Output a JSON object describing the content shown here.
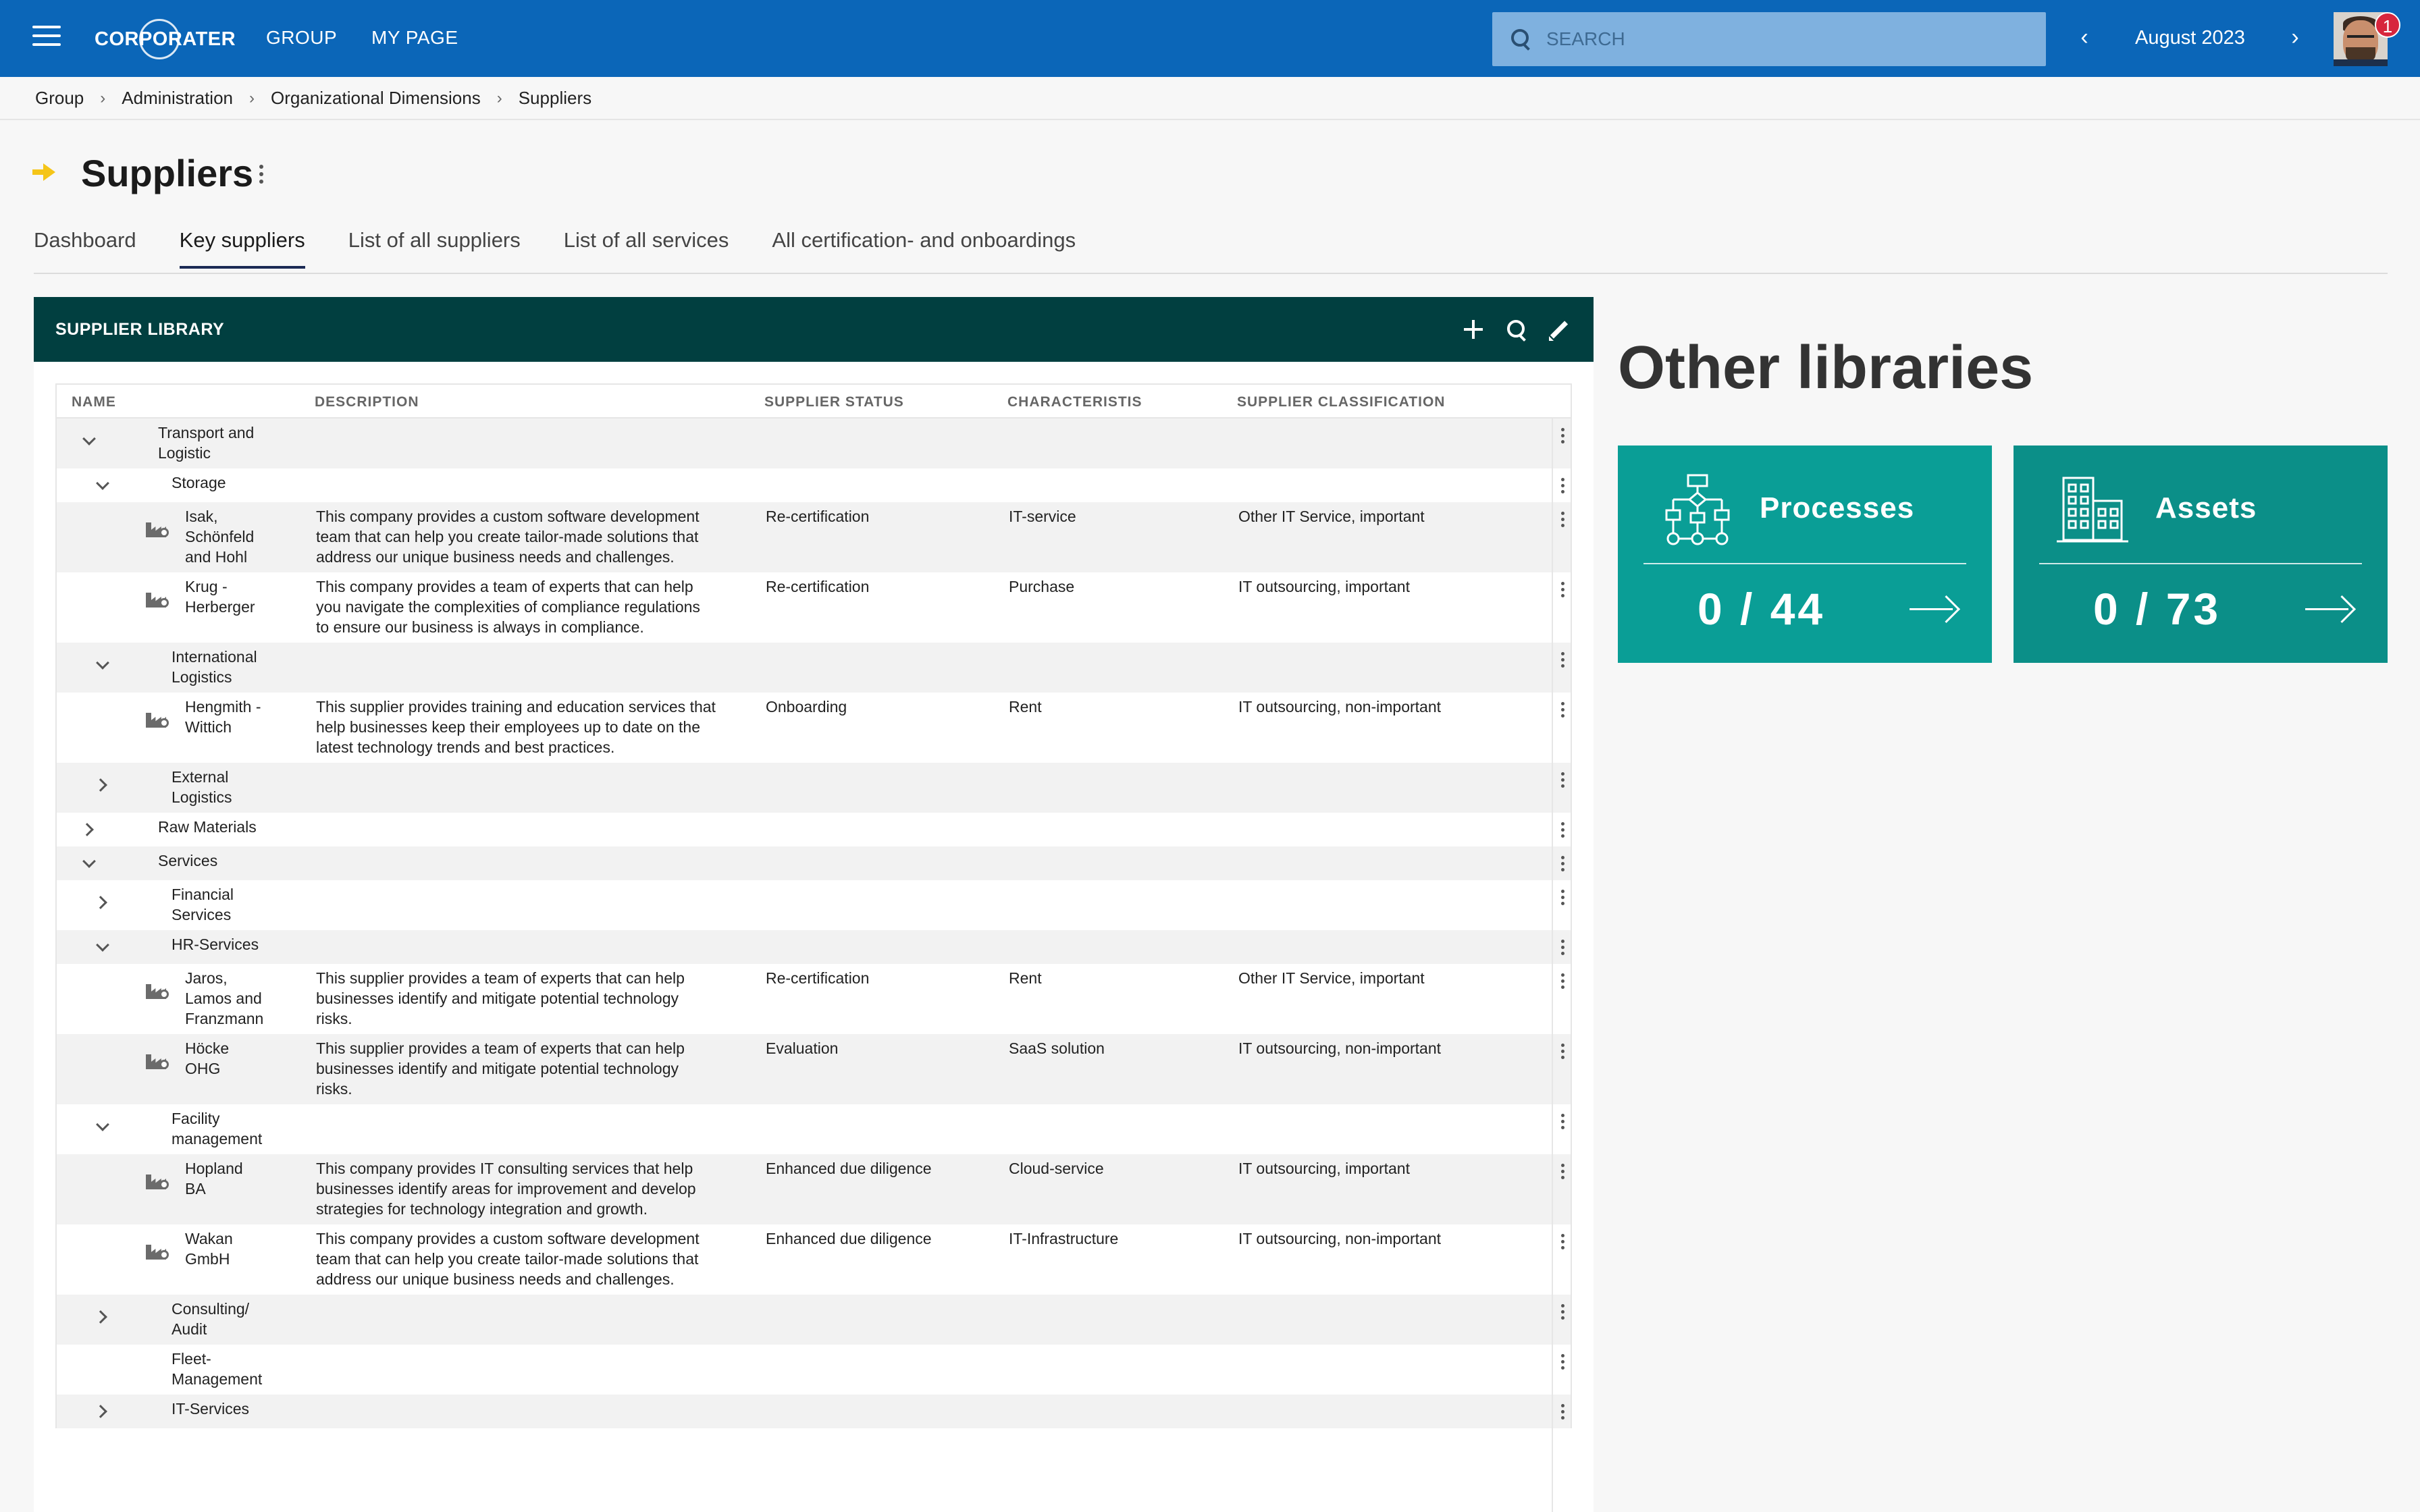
{
  "topbar": {
    "logo": "CORPORATER",
    "nav": [
      "GROUP",
      "MY PAGE"
    ],
    "search_placeholder": "SEARCH",
    "period": "August 2023",
    "notification_count": "1"
  },
  "breadcrumb": [
    "Group",
    "Administration",
    "Organizational Dimensions",
    "Suppliers"
  ],
  "page": {
    "title": "Suppliers"
  },
  "tabs": [
    "Dashboard",
    "Key suppliers",
    "List of all suppliers",
    "List of all services",
    "All certification- and onboardings"
  ],
  "active_tab": "Key suppliers",
  "library": {
    "title": "SUPPLIER LIBRARY",
    "columns": [
      "NAME",
      "DESCRIPTION",
      "SUPPLIER STATUS",
      "CHARACTERISTIS",
      "SUPPLIER CLASSIFICATION"
    ],
    "rows": [
      {
        "level": 0,
        "caret": "down",
        "name": [
          "Transport and",
          "Logistic"
        ]
      },
      {
        "level": 1,
        "caret": "down",
        "name": [
          "Storage"
        ]
      },
      {
        "level": 2,
        "supplier": true,
        "name": [
          "Isak,",
          "Schönfeld",
          "and Hohl"
        ],
        "description": [
          "This company provides a custom software development",
          "team that can help you create tailor-made solutions that",
          "address our unique business needs and challenges."
        ],
        "status": "Re-certification",
        "characteristic": "IT-service",
        "classification": "Other IT Service, important"
      },
      {
        "level": 2,
        "supplier": true,
        "name": [
          "Krug -",
          "Herberger"
        ],
        "description": [
          "This company provides a team of experts that can help",
          "you navigate the complexities of compliance regulations",
          "to ensure our business is always in compliance."
        ],
        "status": "Re-certification",
        "characteristic": "Purchase",
        "classification": "IT outsourcing, important"
      },
      {
        "level": 1,
        "caret": "down",
        "name": [
          "International",
          "Logistics"
        ]
      },
      {
        "level": 2,
        "supplier": true,
        "name": [
          "Hengmith -",
          "Wittich"
        ],
        "description": [
          "This supplier provides training and education services that",
          "help businesses keep their employees up to date on the",
          "latest technology trends and best practices."
        ],
        "status": "Onboarding",
        "characteristic": "Rent",
        "classification": "IT outsourcing, non-important"
      },
      {
        "level": 1,
        "caret": "right",
        "name": [
          "External",
          "Logistics"
        ]
      },
      {
        "level": 0,
        "caret": "right",
        "name": [
          "Raw Materials"
        ]
      },
      {
        "level": 0,
        "caret": "down",
        "name": [
          "Services"
        ]
      },
      {
        "level": 1,
        "caret": "right",
        "name": [
          "Financial",
          "Services"
        ]
      },
      {
        "level": 1,
        "caret": "down",
        "name": [
          "HR-Services"
        ]
      },
      {
        "level": 2,
        "supplier": true,
        "name": [
          "Jaros,",
          "Lamos and",
          "Franzmann"
        ],
        "description": [
          "This supplier provides a team of experts that can help",
          "businesses identify and mitigate potential technology",
          "risks."
        ],
        "status": "Re-certification",
        "characteristic": "Rent",
        "classification": "Other IT Service, important"
      },
      {
        "level": 2,
        "supplier": true,
        "name": [
          "Höcke",
          "OHG"
        ],
        "description": [
          "This supplier provides a team of experts that can help",
          "businesses identify and mitigate potential technology",
          "risks."
        ],
        "status": "Evaluation",
        "characteristic": "SaaS solution",
        "classification": "IT outsourcing, non-important"
      },
      {
        "level": 1,
        "caret": "down",
        "name": [
          "Facility",
          "management"
        ]
      },
      {
        "level": 2,
        "supplier": true,
        "name": [
          "Hopland",
          "BA"
        ],
        "description": [
          "This company provides IT consulting services that help",
          "businesses identify areas for improvement and develop",
          "strategies for technology integration and growth."
        ],
        "status": "Enhanced due diligence",
        "characteristic": "Cloud-service",
        "classification": "IT outsourcing, important"
      },
      {
        "level": 2,
        "supplier": true,
        "name": [
          "Wakan",
          "GmbH"
        ],
        "description": [
          "This company provides a custom software development",
          "team that can help you create tailor-made solutions that",
          "address our unique business needs and challenges."
        ],
        "status": "Enhanced due diligence",
        "characteristic": "IT-Infrastructure",
        "classification": "IT outsourcing, non-important"
      },
      {
        "level": 1,
        "caret": "right",
        "name": [
          "Consulting/",
          "Audit"
        ]
      },
      {
        "level": 1,
        "caret": "none",
        "name": [
          "Fleet-",
          "Management"
        ]
      },
      {
        "level": 1,
        "caret": "right",
        "name": [
          "IT-Services"
        ]
      }
    ]
  },
  "other": {
    "title": "Other libraries",
    "cards": [
      {
        "title": "Processes",
        "count": "0 / 44",
        "icon": "process-flow-icon"
      },
      {
        "title": "Assets",
        "count": "0 / 73",
        "icon": "building-icon"
      }
    ]
  },
  "colors": {
    "topbar": "#0b66b8",
    "library_header": "#013f40",
    "card": "#0a9e96",
    "accent_arrow": "#f5c518"
  }
}
